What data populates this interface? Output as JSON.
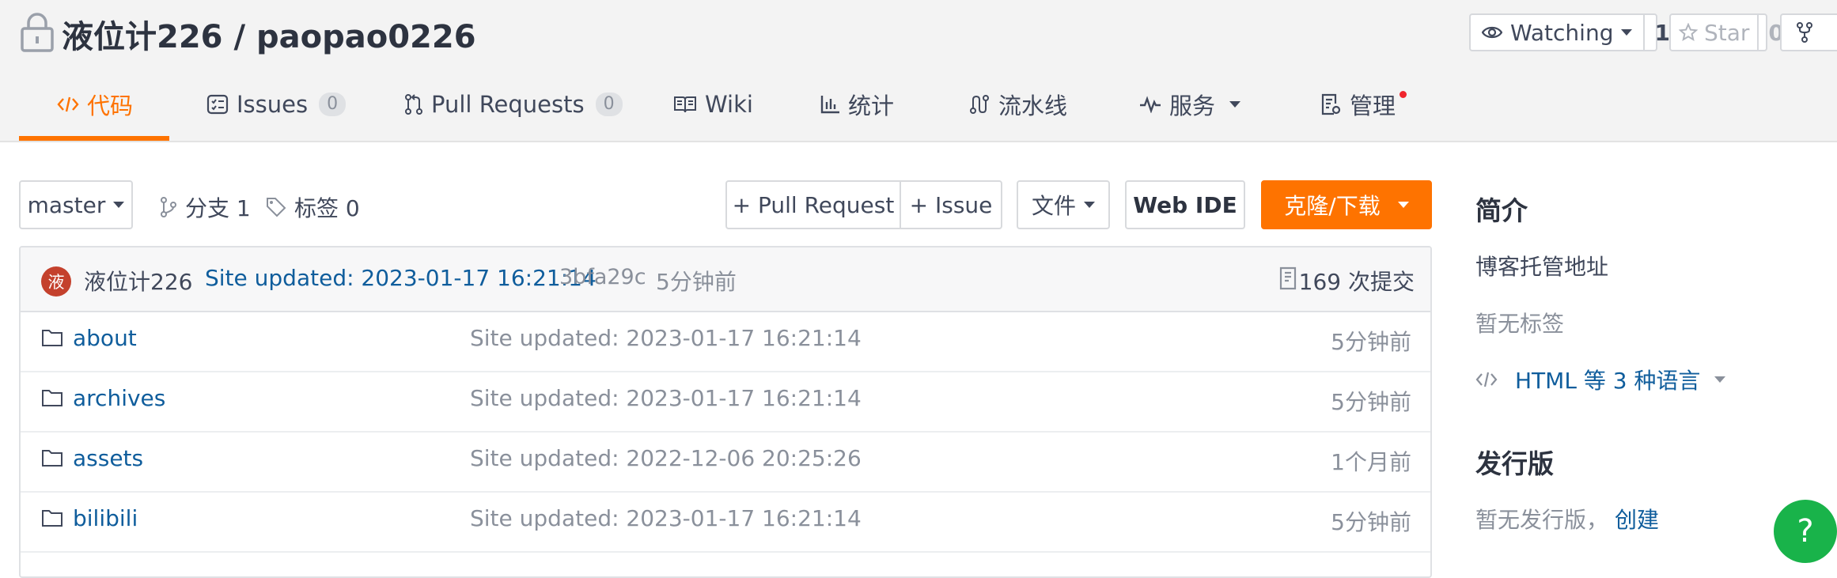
{
  "repo": {
    "owner": "液位计226",
    "separator": "/",
    "name": "paopao0226"
  },
  "header_actions": {
    "watch_label": "Watching",
    "watch_count": "1",
    "star_label": "Star",
    "star_count": "0"
  },
  "tabs": [
    {
      "label": "代码",
      "icon": "code-icon",
      "active": true
    },
    {
      "label": "Issues",
      "badge": "0",
      "icon": "issues-icon"
    },
    {
      "label": "Pull Requests",
      "badge": "0",
      "icon": "pull-request-icon"
    },
    {
      "label": "Wiki",
      "icon": "book-icon"
    },
    {
      "label": "统计",
      "icon": "bar-chart-icon"
    },
    {
      "label": "流水线",
      "icon": "pipeline-icon"
    },
    {
      "label": "服务",
      "icon": "activity-icon",
      "dropdown": true
    },
    {
      "label": "管理",
      "icon": "settings-doc-icon",
      "notification_dot": true
    }
  ],
  "toolbar": {
    "branch": "master",
    "branches_label": "分支 1",
    "tags_label": "标签 0",
    "pull_request_label": "+ Pull Request",
    "issue_label": "+ Issue",
    "files_label": "文件",
    "web_ide_label": "Web IDE",
    "clone_label": "克隆/下载"
  },
  "latest_commit": {
    "avatar_char": "液",
    "author": "液位计226",
    "message": "Site updated: 2023-01-17 16:21:14",
    "hash": "3bfa29c",
    "time": "5分钟前",
    "commit_count": "169 次提交"
  },
  "files": [
    {
      "name": "about",
      "message": "Site updated: 2023-01-17 16:21:14",
      "time": "5分钟前"
    },
    {
      "name": "archives",
      "message": "Site updated: 2023-01-17 16:21:14",
      "time": "5分钟前"
    },
    {
      "name": "assets",
      "message": "Site updated: 2022-12-06 20:25:26",
      "time": "1个月前"
    },
    {
      "name": "bilibili",
      "message": "Site updated: 2023-01-17 16:21:14",
      "time": "5分钟前"
    }
  ],
  "sidebar": {
    "intro_heading": "简介",
    "description": "博客托管地址",
    "tags_empty": "暂无标签",
    "languages": "HTML 等 3 种语言",
    "release_heading": "发行版",
    "release_empty": "暂无发行版，",
    "release_create": "创建"
  },
  "help_label": "?",
  "colors": {
    "accent": "#fe7300",
    "link": "#0f5d9c",
    "help": "#19b34a"
  }
}
